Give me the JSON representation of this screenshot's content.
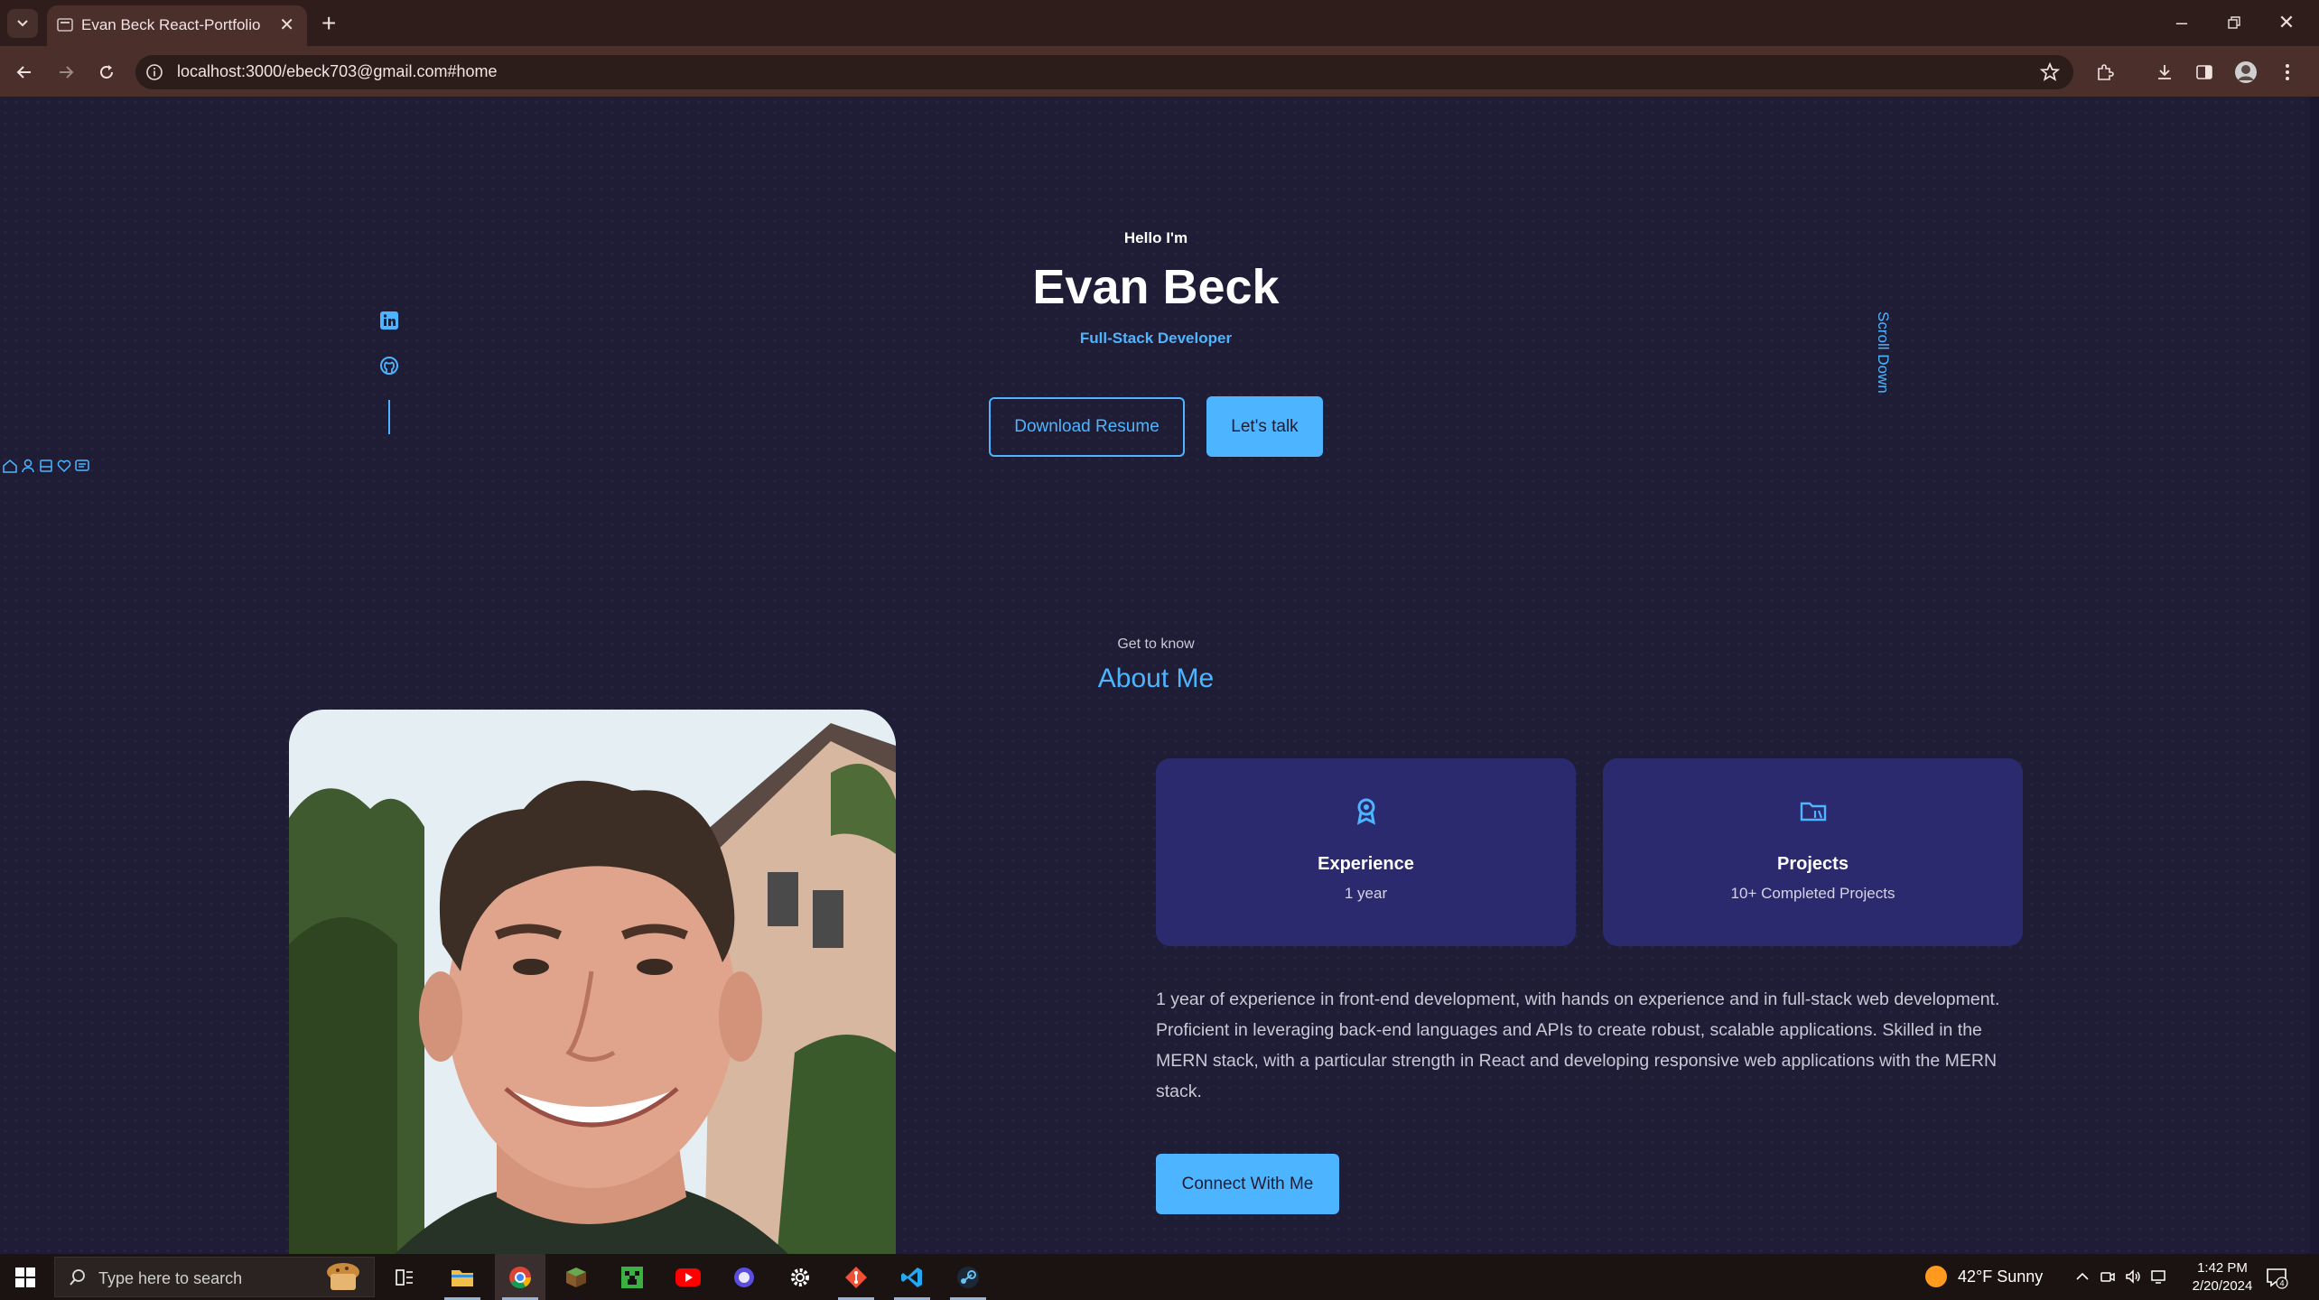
{
  "browser": {
    "tab_title": "Evan Beck React-Portfolio",
    "url": "localhost:3000/ebeck703@gmail.com#home"
  },
  "hero": {
    "greeting": "Hello I'm",
    "name": "Evan Beck",
    "role": "Full-Stack Developer",
    "resume_button": "Download Resume",
    "talk_button": "Let's talk",
    "scroll_label": "Scroll Down",
    "social": [
      "linkedin-icon",
      "github-icon"
    ]
  },
  "about": {
    "kicker": "Get to know",
    "title": "About Me",
    "cards": [
      {
        "icon": "award-icon",
        "title": "Experience",
        "subtitle": "1 year"
      },
      {
        "icon": "folder-icon",
        "title": "Projects",
        "subtitle": "10+ Completed Projects"
      }
    ],
    "body": "1 year of experience in front-end development, with hands on experience and in full-stack web development. Proficient in leveraging back-end languages and APIs to create robust, scalable applications. Skilled in the MERN stack, with a particular strength in React and developing responsive web applications with the MERN stack.",
    "connect_button": "Connect With Me"
  },
  "taskbar": {
    "search_placeholder": "Type here to search",
    "weather": "42°F  Sunny",
    "time": "1:42 PM",
    "date": "2/20/2024",
    "notification_count": "4"
  },
  "colors": {
    "accent": "#4db5ff",
    "page_bg": "#1f1d36",
    "card_bg": "#2c2a6f",
    "chrome_bg": "#4a2f2b"
  }
}
